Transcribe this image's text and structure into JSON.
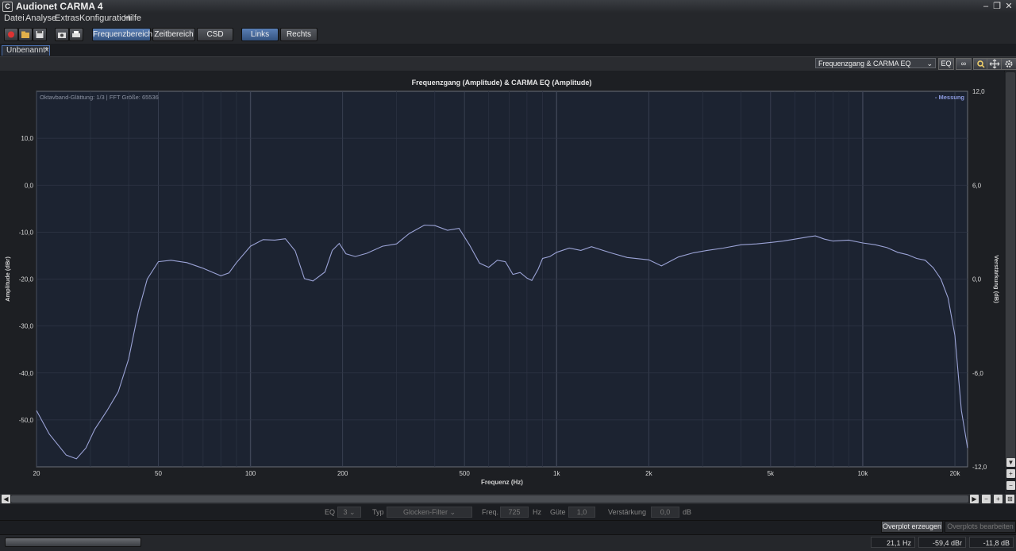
{
  "window": {
    "title": "Audionet CARMA 4",
    "icon_letter": "C"
  },
  "menu": {
    "items": [
      "Datei",
      "Analyse",
      "Extras",
      "Konfiguration",
      "Hilfe"
    ]
  },
  "toolbar": {
    "view_buttons": [
      "Frequenzbereich",
      "Zeitbereich",
      "CSD"
    ],
    "channel_buttons": [
      "Links",
      "Rechts"
    ],
    "active_view": "Frequenzbereich",
    "active_channel": "Links"
  },
  "document_tab": {
    "label": "Unbenannt*",
    "close": "×"
  },
  "chart_toolbar": {
    "view_select": "Frequenzgang & CARMA EQ",
    "eq_button": "EQ",
    "link_button": "∞"
  },
  "chart_data": {
    "type": "line",
    "title": "Frequenzgang (Amplitude) & CARMA EQ (Amplitude)",
    "annotation": "Oktavband-Glättung: 1/3 | FFT Größe: 65536",
    "xlabel": "Frequenz (Hz)",
    "ylabel": "Amplitude (dBr)",
    "y2label": "Verstärkung (dB)",
    "x_scale": "log",
    "xlim": [
      20,
      22000
    ],
    "ylim": [
      -60,
      20
    ],
    "y2lim": [
      -12,
      12
    ],
    "x_ticks": [
      20,
      50,
      100,
      200,
      500,
      1000,
      2000,
      5000,
      10000,
      20000
    ],
    "x_tick_labels": [
      "20",
      "50",
      "100",
      "200",
      "500",
      "1k",
      "2k",
      "5k",
      "10k",
      "20k"
    ],
    "y_ticks": [
      10,
      0,
      -10,
      -20,
      -30,
      -40,
      -50
    ],
    "y_tick_labels": [
      "10,0",
      "0,0",
      "-10,0",
      "-20,0",
      "-30,0",
      "-40,0",
      "-50,0"
    ],
    "y2_ticks": [
      12,
      6,
      0,
      -6,
      -12
    ],
    "y2_tick_labels": [
      "12,0",
      "6,0",
      "0,0",
      "-6,0",
      "-12,0"
    ],
    "grid": true,
    "legend_placement": "top-right",
    "series": [
      {
        "name": "Messung",
        "color": "#9ba3d6",
        "points": [
          [
            20,
            -48
          ],
          [
            22,
            -53
          ],
          [
            25,
            -57.5
          ],
          [
            27,
            -58.3
          ],
          [
            29,
            -56
          ],
          [
            31,
            -52
          ],
          [
            34,
            -48
          ],
          [
            37,
            -44
          ],
          [
            40,
            -37
          ],
          [
            43,
            -27
          ],
          [
            46,
            -20
          ],
          [
            50,
            -16.3
          ],
          [
            55,
            -16
          ],
          [
            62,
            -16.5
          ],
          [
            70,
            -17.7
          ],
          [
            80,
            -19.3
          ],
          [
            85,
            -18.7
          ],
          [
            90,
            -16.5
          ],
          [
            100,
            -13
          ],
          [
            110,
            -11.6
          ],
          [
            120,
            -11.7
          ],
          [
            130,
            -11.4
          ],
          [
            140,
            -14
          ],
          [
            150,
            -19.9
          ],
          [
            160,
            -20.4
          ],
          [
            175,
            -18.5
          ],
          [
            185,
            -13.9
          ],
          [
            195,
            -12.4
          ],
          [
            205,
            -14.6
          ],
          [
            220,
            -15.2
          ],
          [
            240,
            -14.5
          ],
          [
            270,
            -13
          ],
          [
            300,
            -12.5
          ],
          [
            330,
            -10.3
          ],
          [
            370,
            -8.5
          ],
          [
            400,
            -8.6
          ],
          [
            440,
            -9.6
          ],
          [
            480,
            -9.2
          ],
          [
            520,
            -12.8
          ],
          [
            560,
            -16.6
          ],
          [
            600,
            -17.5
          ],
          [
            640,
            -16
          ],
          [
            680,
            -16.3
          ],
          [
            720,
            -19
          ],
          [
            760,
            -18.6
          ],
          [
            800,
            -19.8
          ],
          [
            830,
            -20.3
          ],
          [
            870,
            -17.9
          ],
          [
            900,
            -15.6
          ],
          [
            950,
            -15.2
          ],
          [
            1000,
            -14.3
          ],
          [
            1100,
            -13.4
          ],
          [
            1200,
            -13.9
          ],
          [
            1300,
            -13.1
          ],
          [
            1500,
            -14.4
          ],
          [
            1700,
            -15.4
          ],
          [
            2000,
            -15.9
          ],
          [
            2200,
            -17.2
          ],
          [
            2500,
            -15.3
          ],
          [
            2800,
            -14.4
          ],
          [
            3100,
            -13.9
          ],
          [
            3500,
            -13.4
          ],
          [
            4000,
            -12.7
          ],
          [
            4500,
            -12.5
          ],
          [
            5000,
            -12.2
          ],
          [
            5500,
            -11.9
          ],
          [
            6000,
            -11.5
          ],
          [
            6500,
            -11.1
          ],
          [
            7000,
            -10.8
          ],
          [
            7500,
            -11.5
          ],
          [
            8000,
            -11.9
          ],
          [
            9000,
            -11.7
          ],
          [
            10000,
            -12.3
          ],
          [
            11000,
            -12.7
          ],
          [
            12000,
            -13.3
          ],
          [
            13000,
            -14.3
          ],
          [
            14000,
            -14.8
          ],
          [
            15000,
            -15.6
          ],
          [
            16000,
            -16
          ],
          [
            17000,
            -17.6
          ],
          [
            18000,
            -20
          ],
          [
            19000,
            -24
          ],
          [
            20000,
            -32
          ],
          [
            21000,
            -48
          ],
          [
            22000,
            -56
          ]
        ]
      }
    ]
  },
  "eq_panel": {
    "eq_label": "EQ",
    "eq_value": "3",
    "type_label": "Typ",
    "type_value": "Glocken-Filter",
    "freq_label": "Freq.",
    "freq_value": "725",
    "freq_unit": "Hz",
    "q_label": "Güte",
    "q_value": "1,0",
    "gain_label": "Verstärkung",
    "gain_value": "0,0",
    "gain_unit": "dB"
  },
  "overplot": {
    "create": "Overplot erzeugen",
    "edit": "Overplots bearbeiten"
  },
  "status": {
    "frequency": "21,1 Hz",
    "amplitude": "-59,4 dBr",
    "gain": "-11,8 dB",
    "progress": 0
  }
}
